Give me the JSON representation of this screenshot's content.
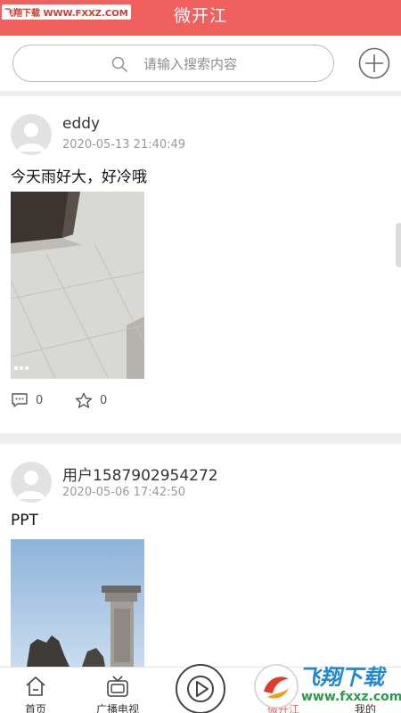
{
  "header": {
    "title": "微开江",
    "watermark": "飞翔下载 WWW.FXXZ.COM"
  },
  "search": {
    "placeholder": "请输入搜索内容"
  },
  "posts": [
    {
      "username": "eddy",
      "timestamp": "2020-05-13 21:40:49",
      "text": "今天雨好大，好冷哦",
      "comment_count": "0",
      "favorite_count": "0"
    },
    {
      "username": "用户1587902954272",
      "timestamp": "2020-05-06 17:42:50",
      "text": "PPT"
    }
  ],
  "tabs": [
    {
      "label": "首页",
      "icon": "home-icon"
    },
    {
      "label": "广播电视",
      "icon": "tv-icon"
    },
    {
      "label": "",
      "icon": "play-icon"
    },
    {
      "label": "微开江",
      "icon": "",
      "active": true
    },
    {
      "label": "我的",
      "icon": ""
    }
  ],
  "watermark_br": {
    "line1": "飞翔下载",
    "line2": "www.fxxz.com"
  },
  "colors": {
    "accent": "#f0605e",
    "divider": "#eeeeee"
  }
}
